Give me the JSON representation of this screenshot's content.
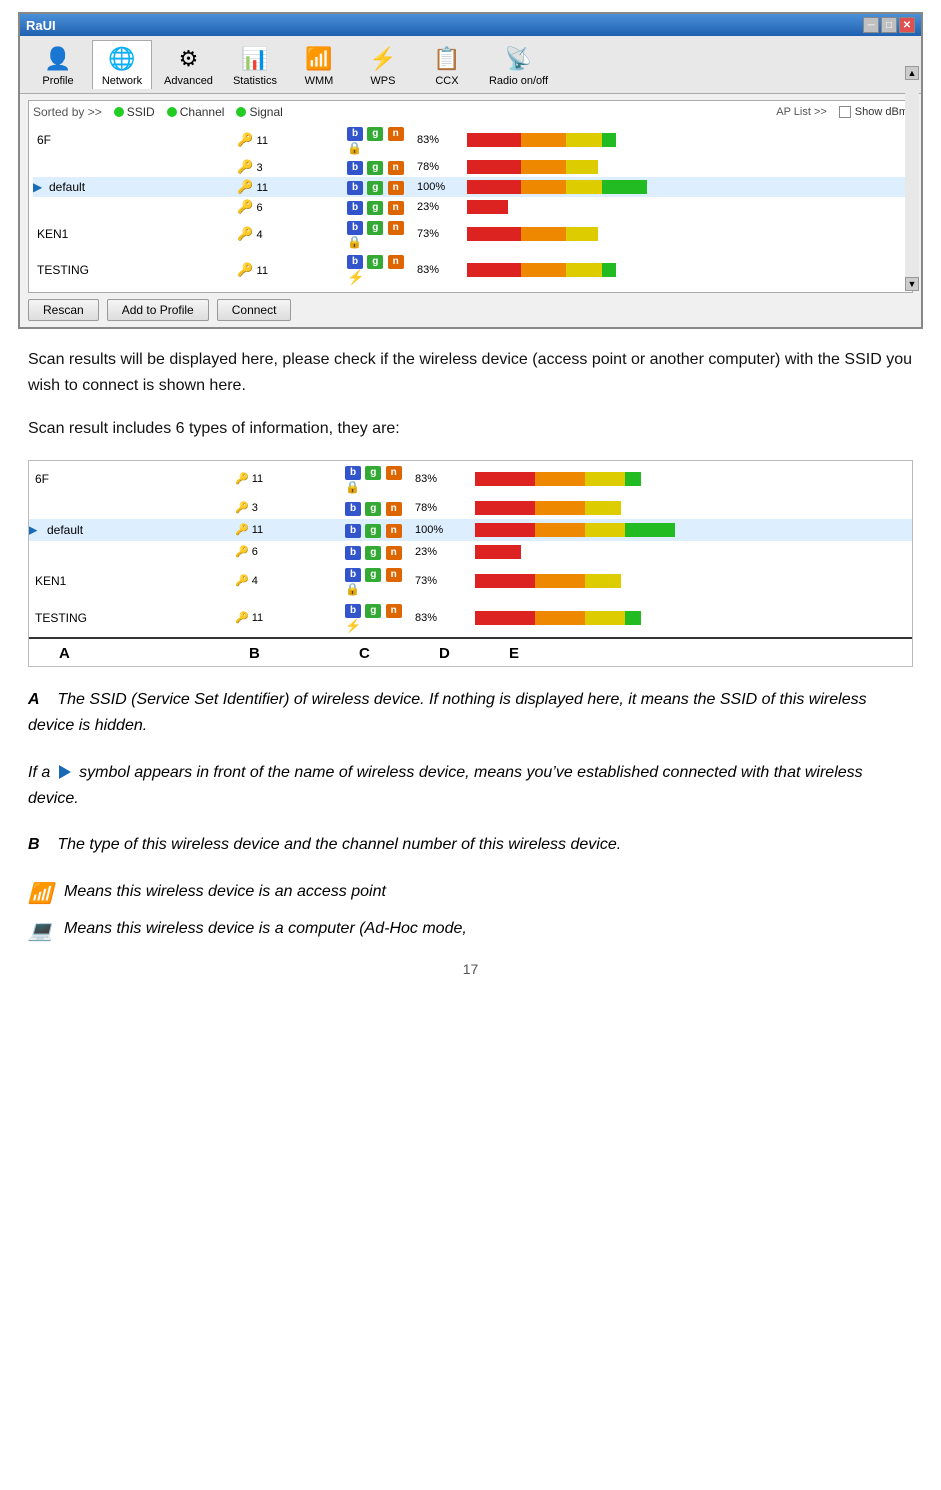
{
  "window": {
    "title": "RaUI",
    "close_label": "✕",
    "minimize_label": "─",
    "maximize_label": "□"
  },
  "toolbar": {
    "items": [
      {
        "label": "Profile",
        "icon": "👤"
      },
      {
        "label": "Network",
        "icon": "🌐"
      },
      {
        "label": "Advanced",
        "icon": "⚙"
      },
      {
        "label": "Statistics",
        "icon": "📊"
      },
      {
        "label": "WMM",
        "icon": "📶"
      },
      {
        "label": "WPS",
        "icon": "⚡"
      },
      {
        "label": "CCX",
        "icon": "📋"
      },
      {
        "label": "Radio on/off",
        "icon": "📡"
      }
    ],
    "active_index": 1
  },
  "ap_header": {
    "sorted_by": "Sorted by >>",
    "ssid_label": "SSID",
    "channel_label": "Channel",
    "signal_label": "Signal",
    "ap_list_label": "AP List >>",
    "show_dbm_label": "Show dBm"
  },
  "ap_rows": [
    {
      "ssid": "6F",
      "channel1": "11",
      "channel2": "3",
      "percent1": "83%",
      "percent2": "78%",
      "bars1": 83,
      "bars2": 78,
      "current": false
    },
    {
      "ssid": "default",
      "channel1": "11",
      "channel2": "6",
      "percent1": "100%",
      "percent2": "23%",
      "bars1": 100,
      "bars2": 23,
      "current": true
    },
    {
      "ssid": "KEN1",
      "channel1": "4",
      "percent1": "73%",
      "bars1": 73,
      "current": false
    },
    {
      "ssid": "TESTING",
      "channel1": "11",
      "percent1": "83%",
      "bars1": 83,
      "current": false
    }
  ],
  "buttons": {
    "rescan": "Rescan",
    "add_profile": "Add to Profile",
    "connect": "Connect"
  },
  "paragraphs": {
    "p1": "Scan results will be displayed here, please check if the wireless device (access point or another computer) with the SSID you wish to connect is shown here.",
    "p2": "Scan result includes 6 types of information, they are:"
  },
  "diagram": {
    "labels": [
      "A",
      "B",
      "C",
      "D",
      "E"
    ],
    "rows": [
      {
        "ssid": "6F",
        "channel1": "11",
        "channel2": "3",
        "percent1": "83%",
        "percent2": "78%",
        "bars1": 83,
        "bars2": 78,
        "current": false
      },
      {
        "ssid": "default",
        "channel1": "11",
        "channel2": "6",
        "percent1": "100%",
        "percent2": "23%",
        "bars1": 100,
        "bars2": 23,
        "current": true
      },
      {
        "ssid": "KEN1",
        "channel1": "4",
        "percent1": "73%",
        "bars1": 73,
        "current": false
      },
      {
        "ssid": "TESTING",
        "channel1": "11",
        "percent1": "83%",
        "bars1": 83,
        "current": false
      }
    ]
  },
  "descriptions": {
    "a_label": "A",
    "a_text": "The SSID (Service Set Identifier) of wireless device. If nothing is displayed here, it means the SSID of this wireless device is hidden.",
    "arrow_text": "If a",
    "arrow_desc": "symbol appears in front of the name of wireless device, means you’ve established connected with that wireless device.",
    "b_label": "B",
    "b_text": "The type of this wireless device and the channel number of this wireless device.",
    "icon1_desc": "Means this wireless device is an access point",
    "icon2_desc": "Means this wireless device is a computer (Ad-Hoc mode,"
  },
  "page_number": "17"
}
